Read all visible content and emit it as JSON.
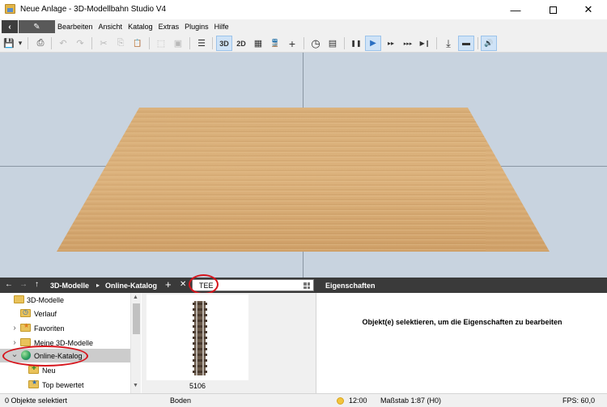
{
  "window": {
    "title": "Neue Anlage - 3D-Modellbahn Studio V4",
    "minimize": "—",
    "close": "✕"
  },
  "menubar": {
    "back": "‹",
    "edit": "✎",
    "items": [
      "Bearbeiten",
      "Ansicht",
      "Katalog",
      "Extras",
      "Plugins",
      "Hilfe"
    ]
  },
  "toolbar": {
    "save": "💾",
    "save_dropdown": "▾",
    "print": "⎙",
    "undo": "↶",
    "redo": "↷",
    "cut": "✂",
    "copy": "⎘",
    "paste": "📋",
    "select_frame": "⬚",
    "group": "▣",
    "layers": "☰",
    "mode_3d": "3D",
    "mode_2d": "2D",
    "grid": "▦",
    "train": "🚆",
    "add": "+",
    "clock": "◷",
    "camera": "▤",
    "pause": "❚❚",
    "play": "▶",
    "fast": "▸▸",
    "faster": "▸▸▸",
    "step": "▶❙",
    "import": "⤓",
    "ruler": "▬",
    "sound": "🔊"
  },
  "panelbar": {
    "back": "←",
    "forward": "→",
    "up": "↑",
    "crumb1": "3D-Modelle",
    "crumb_sep": "▸",
    "crumb2": "Online-Katalog",
    "add": "+",
    "close": "✕",
    "search_value": "TEE",
    "properties_title": "Eigenschaften"
  },
  "tree": {
    "items": [
      {
        "label": "3D-Modelle",
        "arrow": ""
      },
      {
        "label": "Verlauf",
        "arrow": ""
      },
      {
        "label": "Favoriten",
        "arrow": "›"
      },
      {
        "label": "Meine 3D-Modelle",
        "arrow": "›"
      },
      {
        "label": "Online-Katalog",
        "arrow": "⌄"
      },
      {
        "label": "Neu",
        "arrow": ""
      },
      {
        "label": "Top bewertet",
        "arrow": ""
      }
    ],
    "selected_index": 4
  },
  "results": {
    "items": [
      {
        "label": "5106"
      }
    ]
  },
  "properties": {
    "message": "Objekt(e) selektieren, um die Eigenschaften zu bearbeiten"
  },
  "status": {
    "selection": "0 Objekte selektiert",
    "surface": "Boden",
    "time": "12:00",
    "scale": "Maßstab 1:87 (H0)",
    "fps": "FPS: 60,0"
  },
  "colors": {
    "viewport_bg": "#c8d3df",
    "panel_header": "#3a3a3a",
    "highlight": "#d6141c",
    "active_button": "#cfe3f7"
  }
}
